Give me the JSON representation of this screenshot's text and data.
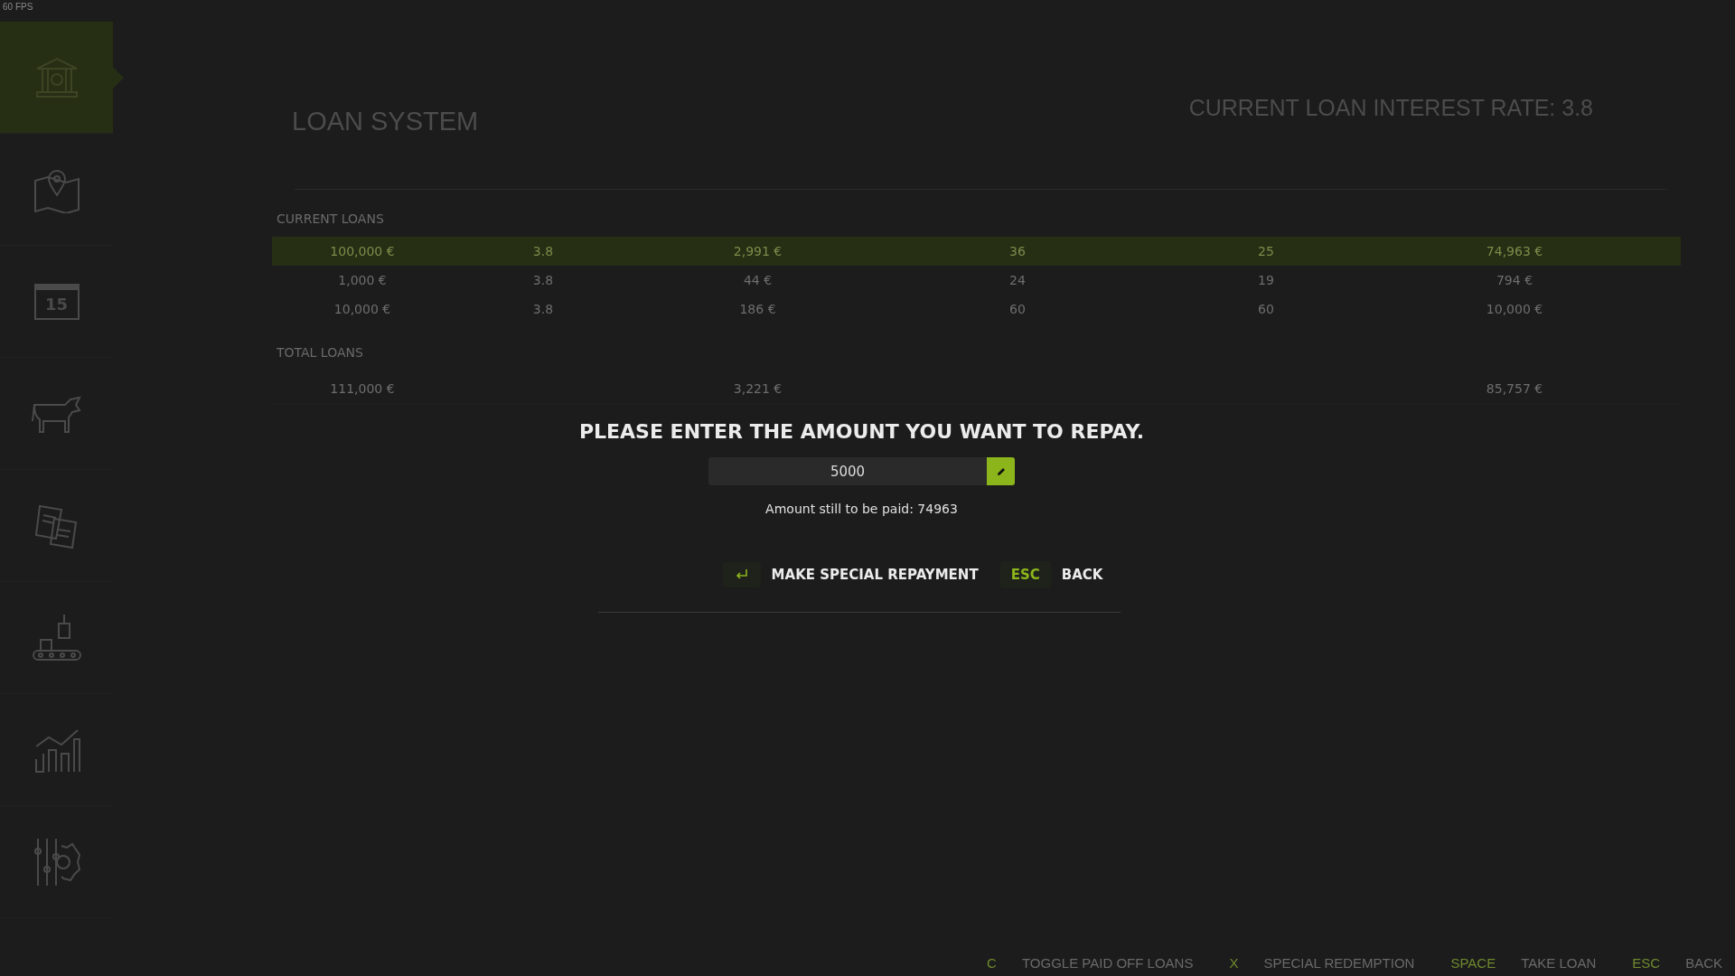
{
  "fps": "60 FPS",
  "sidebar": {
    "items": [
      {
        "kind": "bank",
        "selected": true
      },
      {
        "kind": "map",
        "selected": false
      },
      {
        "kind": "calendar",
        "selected": false,
        "label": "15"
      },
      {
        "kind": "cow",
        "selected": false
      },
      {
        "kind": "papers",
        "selected": false
      },
      {
        "kind": "production",
        "selected": false
      },
      {
        "kind": "chart",
        "selected": false
      },
      {
        "kind": "settings",
        "selected": false
      }
    ]
  },
  "page": {
    "title": "LOAN SYSTEM",
    "interest_rate": "CURRENT LOAN INTEREST RATE: 3.8"
  },
  "current_loans": {
    "title": "CURRENT LOANS",
    "rows": [
      {
        "selected": true,
        "cells": [
          "100,000 €",
          "3.8",
          "2,991 €",
          "36",
          "25",
          "74,963 €"
        ]
      },
      {
        "selected": false,
        "cells": [
          "1,000 €",
          "3.8",
          "44 €",
          "24",
          "19",
          "794 €"
        ]
      },
      {
        "selected": false,
        "cells": [
          "10,000 €",
          "3.8",
          "186 €",
          "60",
          "60",
          "10,000 €"
        ]
      }
    ]
  },
  "total_loans": {
    "title": "TOTAL LOANS",
    "cells": [
      "111,000 €",
      "",
      "3,221 €",
      "",
      "",
      "85,757 €"
    ]
  },
  "dialog": {
    "title": "PLEASE ENTER THE AMOUNT YOU WANT TO REPAY.",
    "amount": "5000",
    "remaining": "Amount still to be paid: 74963",
    "actions": [
      {
        "kind": "enter",
        "label": "MAKE SPECIAL REPAYMENT"
      },
      {
        "kind": "key",
        "key": "ESC",
        "label": "BACK"
      }
    ]
  },
  "footer": {
    "actions": [
      {
        "key": "C",
        "label": "TOGGLE PAID OFF LOANS"
      },
      {
        "key": "X",
        "label": "SPECIAL REDEMPTION"
      },
      {
        "key": "SPACE",
        "label": "TAKE LOAN"
      },
      {
        "key": "ESC",
        "label": "BACK"
      }
    ]
  }
}
